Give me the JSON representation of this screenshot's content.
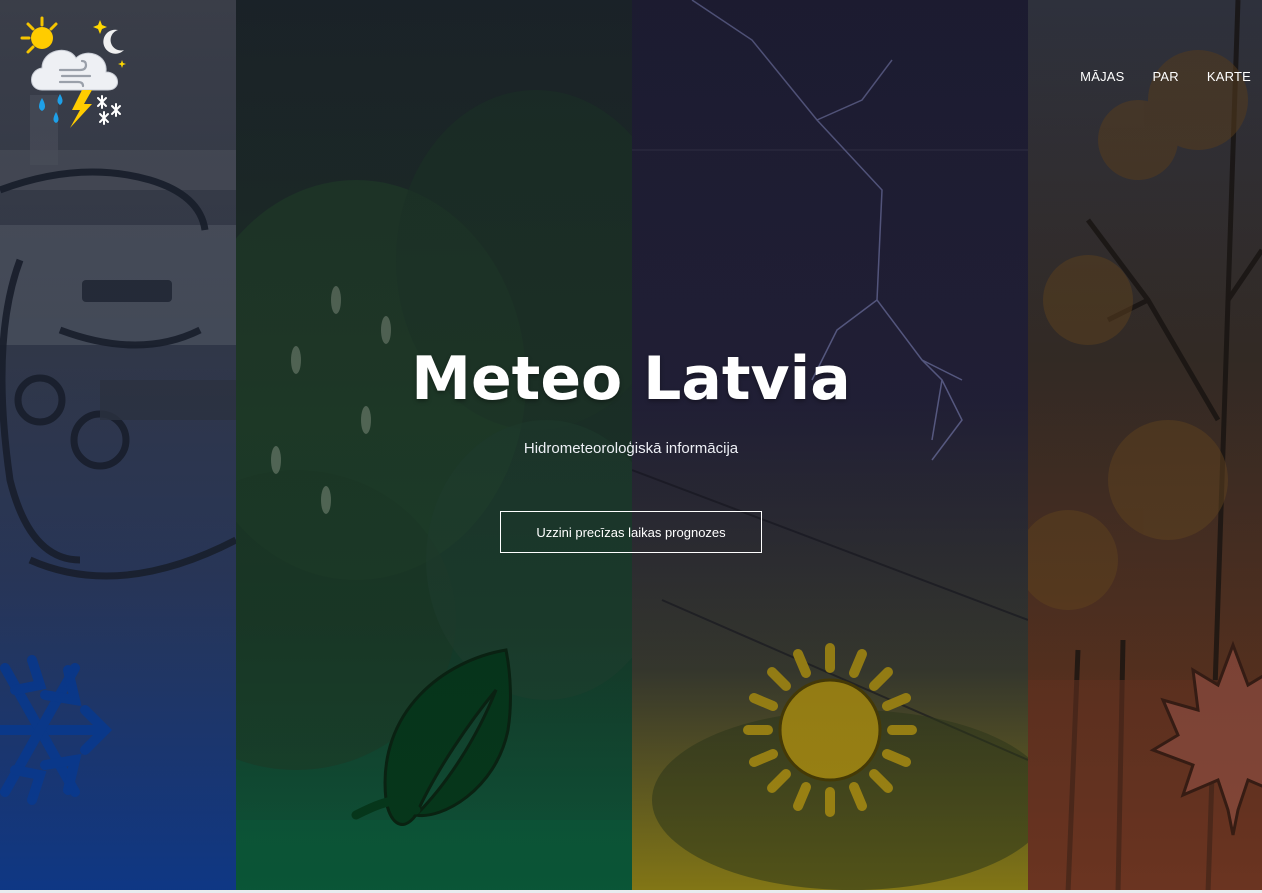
{
  "site": {
    "title": "Meteo Latvia",
    "subtitle": "Hidrometeoroloģiskā informācija"
  },
  "nav": {
    "items": [
      {
        "label": "MĀJAS"
      },
      {
        "label": "PAR"
      },
      {
        "label": "KARTE"
      }
    ]
  },
  "hero": {
    "cta_label": "Uzzini precīzas laikas prognozes"
  },
  "seasons": [
    {
      "name": "winter",
      "icon": "snowflake-icon",
      "accent": "#0b3a8a"
    },
    {
      "name": "spring",
      "icon": "leaf-icon",
      "accent": "#063a1c"
    },
    {
      "name": "summer",
      "icon": "sun-icon",
      "accent": "#a08a12"
    },
    {
      "name": "autumn",
      "icon": "maple-leaf-icon",
      "accent": "#8a4a3a"
    }
  ],
  "logo": {
    "icon": "weather-logo-icon"
  }
}
